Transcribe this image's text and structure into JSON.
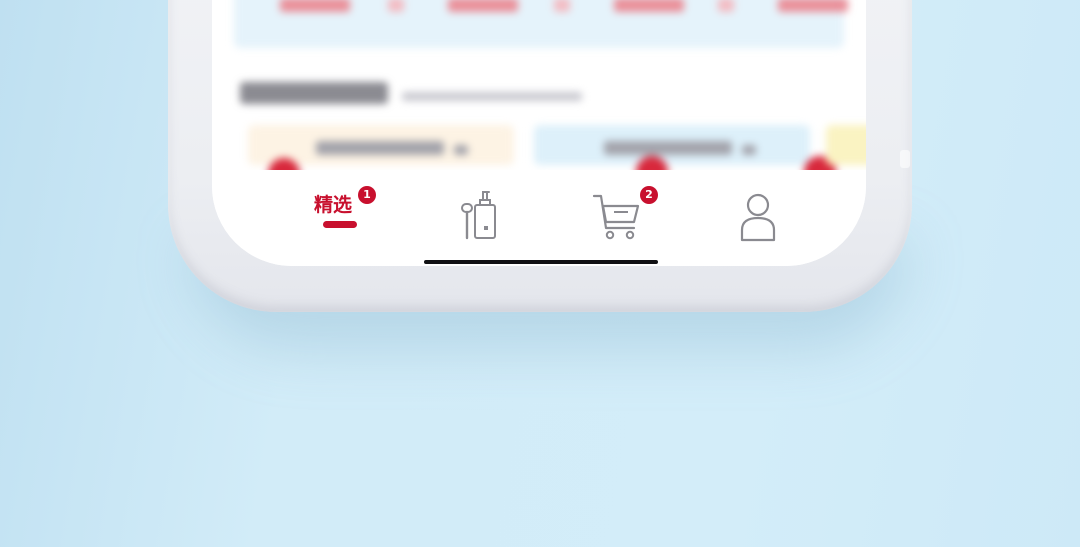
{
  "tabbar": {
    "tabs": [
      {
        "label": "精选",
        "icon": "home-featured-icon",
        "active": true,
        "badge": "1"
      },
      {
        "label": "",
        "icon": "cosmetics-icon",
        "active": false,
        "badge": ""
      },
      {
        "label": "",
        "icon": "shopping-cart-icon",
        "active": false,
        "badge": "2"
      },
      {
        "label": "",
        "icon": "profile-icon",
        "active": false,
        "badge": ""
      }
    ]
  },
  "colors": {
    "background": "#cfeaf8",
    "accent": "#c8102e",
    "icon_gray": "#8a8a90"
  }
}
